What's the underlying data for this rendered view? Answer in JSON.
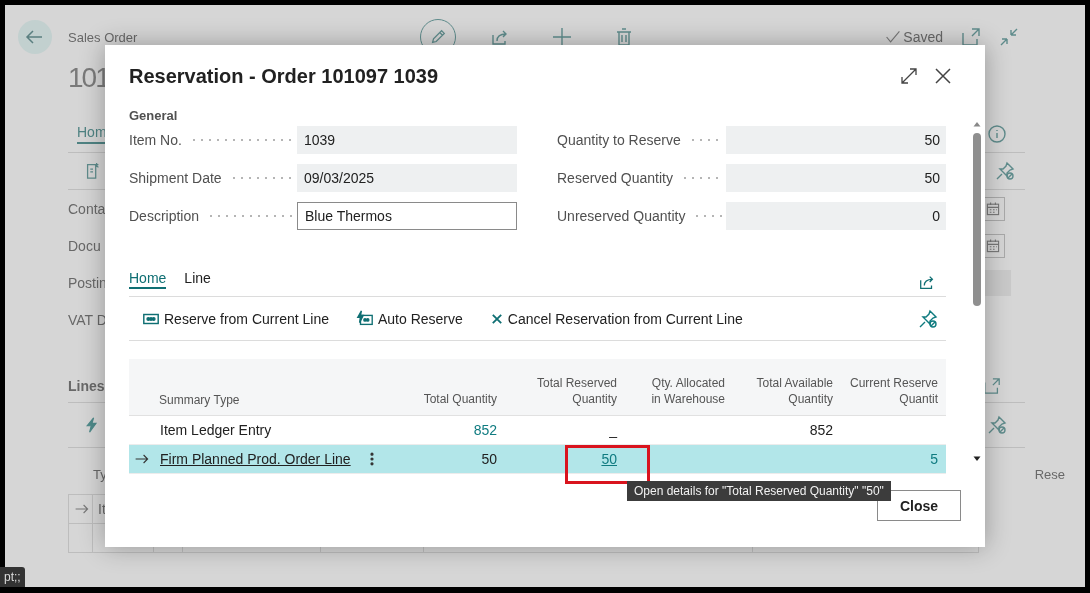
{
  "background": {
    "caption": "Sales Order",
    "record_no": "101",
    "saved_label": "Saved",
    "tabs": [
      {
        "label": "Hom",
        "selected": true
      }
    ],
    "fields": [
      {
        "label": "Conta",
        "kind": "date"
      },
      {
        "label": "Docu",
        "kind": "date"
      },
      {
        "label": "Postin",
        "kind": "input"
      },
      {
        "label": "VAT D",
        "kind": "plain"
      }
    ],
    "lines": {
      "title": "Lines",
      "column": "Ty",
      "row": "It",
      "side_label": "Rese"
    },
    "tip": "pt;;"
  },
  "dialog": {
    "title": "Reservation - Order 101097 1039",
    "section": "General",
    "fields_left": [
      {
        "label": "Item No.",
        "value": "1039",
        "editable": false
      },
      {
        "label": "Shipment Date",
        "value": "09/03/2025",
        "editable": false
      },
      {
        "label": "Description",
        "value": "Blue Thermos",
        "editable": true
      }
    ],
    "fields_right": [
      {
        "label": "Quantity to Reserve",
        "value": "50",
        "editable": false
      },
      {
        "label": "Reserved Quantity",
        "value": "50",
        "editable": false
      },
      {
        "label": "Unreserved Quantity",
        "value": "0",
        "editable": false
      }
    ],
    "tabs": [
      {
        "label": "Home",
        "selected": true
      },
      {
        "label": "Line",
        "selected": false
      }
    ],
    "actions": [
      {
        "label": "Reserve from Current Line",
        "kind": "reserve"
      },
      {
        "label": "Auto Reserve",
        "kind": "auto"
      },
      {
        "label": "Cancel Reservation from Current Line",
        "kind": "cancel"
      }
    ],
    "table": {
      "columns": [
        {
          "lines": [
            "Summary Type"
          ]
        },
        {
          "lines": [
            "Total Quantity"
          ]
        },
        {
          "lines": [
            "Total Reserved",
            "Quantity"
          ]
        },
        {
          "lines": [
            "Qty. Allocated",
            "in Warehouse"
          ]
        },
        {
          "lines": [
            "Total Available",
            "Quantity"
          ]
        },
        {
          "lines": [
            "Current Reserve",
            "Quantit"
          ]
        }
      ],
      "rows": [
        {
          "selected": false,
          "cells": [
            {
              "text": "Item Ledger Entry",
              "kind": "plain",
              "highlighted": false
            },
            {
              "text": "852",
              "kind": "drilldown",
              "highlighted": false
            },
            {
              "text": "_",
              "kind": "plain",
              "highlighted": false
            },
            null,
            {
              "text": "852",
              "kind": "plain",
              "highlighted": false
            },
            null
          ]
        },
        {
          "selected": true,
          "cells": [
            {
              "text": "Firm Planned Prod. Order Line",
              "kind": "link",
              "highlighted": false
            },
            {
              "text": "50",
              "kind": "plain",
              "highlighted": false
            },
            {
              "text": "50",
              "kind": "drilldown-link",
              "highlighted": true
            },
            null,
            null,
            {
              "text": "5",
              "kind": "drilldown",
              "highlighted": false
            }
          ]
        }
      ]
    },
    "tooltip": "Open details for \"Total Reserved Quantity\" \"50\"",
    "close_label": "Close"
  }
}
